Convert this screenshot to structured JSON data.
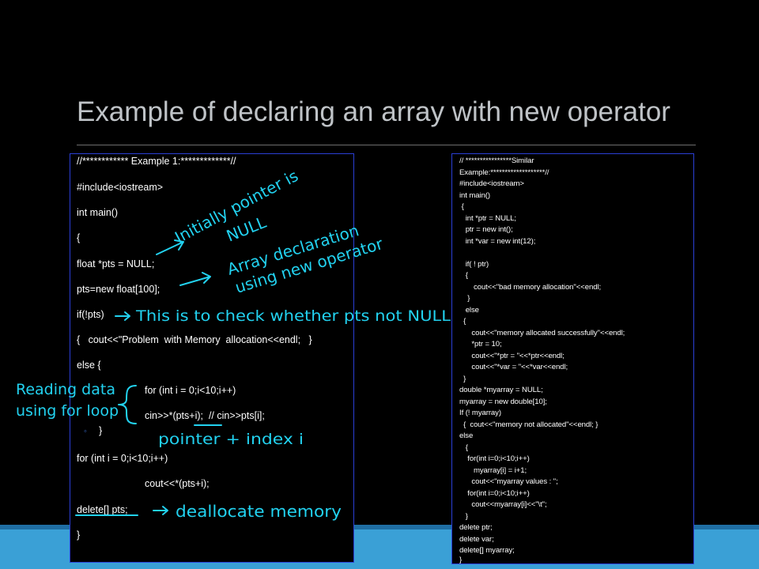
{
  "slide": {
    "title": "Example of declaring an array with new operator"
  },
  "code_left": {
    "lines": [
      "//************ Example 1:*************//",
      "#include<iostream>",
      "int main()",
      "{",
      "float *pts = NULL;",
      "pts=new float[100];",
      "if(!pts)",
      "{   cout<<\"Problem  with Memory  allocation<<endl;   }",
      "else {",
      "for (int i = 0;i<10;i++)",
      "cin>>*(pts+i);  // cin>>pts[i];",
      "}",
      "for (int i = 0;i<10;i++)",
      "cout<<*(pts+i);",
      "delete[] pts;",
      "}"
    ]
  },
  "code_right": {
    "lines": [
      "// ****************Similar",
      "Example:*******************//",
      "#include<iostream>",
      "int main()",
      " {",
      "   int *ptr = NULL;",
      "   ptr = new int();",
      "   int *var = new int(12);",
      "",
      "   if( ! ptr)",
      "   {",
      "       cout<<\"bad memory allocation\"<<endl;",
      "    }",
      "   else",
      "  {",
      "      cout<<\"memory allocated successfully\"<<endl;",
      "      *ptr = 10;",
      "      cout<<\"*ptr = \"<<*ptr<<endl;",
      "      cout<<\"*var = \"<<*var<<endl;",
      "  }",
      "double *myarray = NULL;",
      "myarray = new double[10];",
      "If (! myarray)",
      "  {  cout<<\"memory not allocated\"<<endl; }",
      "else",
      "   {",
      "    for(int i=0;i<10;i++)",
      "       myarray[i] = i+1;",
      "      cout<<\"myarray values : \";",
      "    for(int i=0;i<10;i++)",
      "      cout<<myarray[i]<<\"\\t\";",
      "   }",
      "delete ptr;",
      "delete var;",
      "delete[] myarray;",
      "}"
    ]
  },
  "annotations": {
    "initially_line1": "Initially pointer is",
    "initially_line2": "NULL",
    "array_decl_line1": "Array declaration",
    "array_decl_line2": "using new operator",
    "check_null": "This is to check whether pts not NULL",
    "reading_line1": "Reading data",
    "reading_line2": "using for loop",
    "pointer_index": "pointer + index i",
    "dealloc": "deallocate memory"
  },
  "colors": {
    "background": "#000000",
    "title": "#bfc3c7",
    "box_border": "#2a3fd6",
    "handwriting": "#22d2f0",
    "band": "#3aa0d6"
  }
}
